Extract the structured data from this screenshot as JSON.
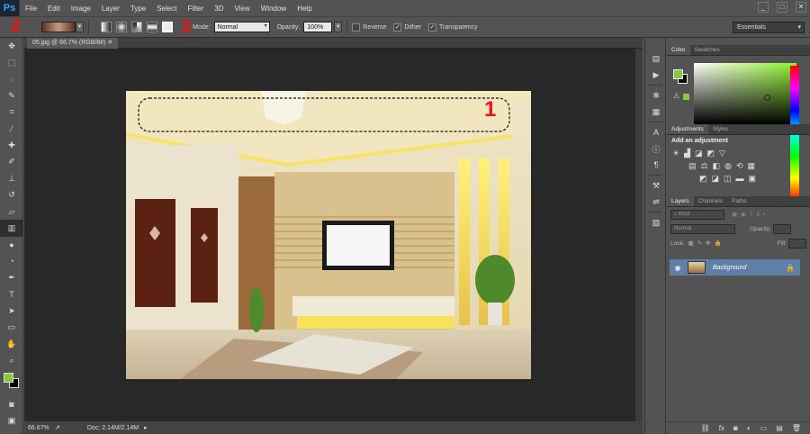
{
  "app": {
    "logo": "Ps",
    "menu": [
      "File",
      "Edit",
      "Image",
      "Layer",
      "Type",
      "Select",
      "Filter",
      "3D",
      "View",
      "Window",
      "Help"
    ],
    "win": [
      "_",
      "□",
      "✕"
    ]
  },
  "options": {
    "mode_label": "Mode:",
    "mode_value": "Normal",
    "opacity_label": "Opacity:",
    "opacity_value": "100%",
    "reverse": "Reverse",
    "dither": "Dither",
    "transparency": "Transparency",
    "workspace": "Essentials",
    "annotation_2": "2",
    "annotation_3": "3"
  },
  "document": {
    "tab": "05.jpg @ 66.7% (RGB/8#)",
    "annotation_1": "1",
    "zoom": "66.67%",
    "doc_size": "Doc: 2.14M/2.14M"
  },
  "panels": {
    "color_tab": "Color",
    "swatches_tab": "Swatches",
    "adjustments_tab": "Adjustments",
    "styles_tab": "Styles",
    "add_adjustment": "Add an adjustment",
    "layers_tab": "Layers",
    "channels_tab": "Channels",
    "paths_tab": "Paths",
    "kind": "Kind",
    "blend": "Normal",
    "opacity_label": "Opacity:",
    "lock_label": "Lock:",
    "fill_label": "Fill:",
    "layer_name": "Background",
    "colors": {
      "foreground": "#8cc63f",
      "background": "#000000"
    }
  }
}
